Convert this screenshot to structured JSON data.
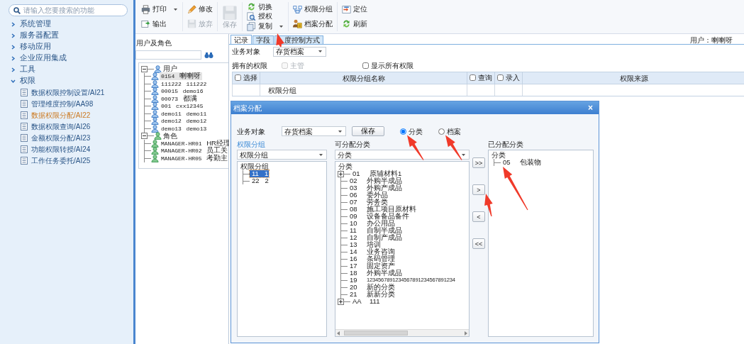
{
  "sidebar": {
    "search": {
      "placeholder": "请输入您要搜索的功能"
    },
    "items": [
      {
        "label": "系统管理",
        "expanded": false
      },
      {
        "label": "服务器配置",
        "expanded": false
      },
      {
        "label": "移动应用",
        "expanded": false
      },
      {
        "label": "企业应用集成",
        "expanded": false
      },
      {
        "label": "工具",
        "expanded": false
      },
      {
        "label": "权限",
        "expanded": true,
        "children": [
          {
            "label": "数据权限控制设置/AI21",
            "selected": false
          },
          {
            "label": "管理维度控制/AA98",
            "selected": false
          },
          {
            "label": "数据权限分配/AI22",
            "selected": true
          },
          {
            "label": "数据权限查询/AI26",
            "selected": false
          },
          {
            "label": "金额权限分配/AI23",
            "selected": false
          },
          {
            "label": "功能权限转授/AI24",
            "selected": false
          },
          {
            "label": "工作任务委托/AI25",
            "selected": false
          }
        ]
      }
    ]
  },
  "toolbar": {
    "groups": [
      {
        "kind": "stack",
        "buttons": [
          {
            "label": "打印",
            "dropdown": true,
            "disabled": false
          },
          {
            "label": "输出",
            "dropdown": false,
            "disabled": false
          }
        ]
      },
      {
        "kind": "stack",
        "buttons": [
          {
            "label": "修改",
            "dropdown": false,
            "disabled": false
          },
          {
            "label": "放弃",
            "dropdown": false,
            "disabled": true
          }
        ]
      },
      {
        "kind": "large",
        "buttons": [
          {
            "label": "保存",
            "dropdown": false,
            "disabled": true
          }
        ]
      },
      {
        "kind": "stack",
        "buttons": [
          {
            "label": "切换",
            "dropdown": false,
            "disabled": false
          },
          {
            "label": "授权",
            "dropdown": false,
            "disabled": false
          },
          {
            "label": "复制",
            "dropdown": true,
            "disabled": false
          }
        ]
      },
      {
        "kind": "stack",
        "buttons": [
          {
            "label": "权限分组",
            "dropdown": false,
            "disabled": false
          },
          {
            "label": "档案分配",
            "dropdown": false,
            "disabled": false
          }
        ]
      },
      {
        "kind": "stack",
        "buttons": [
          {
            "label": "定位",
            "dropdown": false,
            "disabled": false
          },
          {
            "label": "刷新",
            "dropdown": false,
            "disabled": false
          }
        ]
      }
    ]
  },
  "users_panel": {
    "title": "用户及角色",
    "tree": [
      {
        "label": "用户",
        "kind": "user",
        "expanded": true,
        "children": [
          {
            "code": "0154",
            "name": "喇喇呀",
            "selected": true
          },
          {
            "code": "111222",
            "name": "111222",
            "selected": false
          },
          {
            "code": "00015",
            "name": "demo16",
            "selected": false
          },
          {
            "code": "00073",
            "name": "都满",
            "selected": false
          },
          {
            "code": "001",
            "name": "cxx12345",
            "selected": false
          },
          {
            "code": "demo11",
            "name": "demo11",
            "selected": false
          },
          {
            "code": "demo12",
            "name": "demo12",
            "selected": false
          },
          {
            "code": "demo13",
            "name": "demo13",
            "selected": false
          }
        ]
      },
      {
        "label": "角色",
        "kind": "role",
        "expanded": true,
        "children": [
          {
            "code": "MANAGER-HR01",
            "name": "HR经理",
            "selected": false
          },
          {
            "code": "MANAGER-HR02",
            "name": "员工关",
            "selected": false
          },
          {
            "code": "MANAGER-HR05",
            "name": "考勤主",
            "selected": false
          }
        ]
      }
    ]
  },
  "main": {
    "tabs": [
      {
        "label": "记录",
        "selected": true
      },
      {
        "label": "字段",
        "selected": false
      },
      {
        "label": "度控制方式",
        "selected": false
      }
    ],
    "user": "用户：喇喇呀",
    "business_object": {
      "label": "业务对象",
      "value": "存货档案"
    },
    "owned_label": "拥有的权限",
    "options": [
      {
        "label": "主管",
        "checked": false,
        "disabled": true
      },
      {
        "label": "显示所有权限",
        "checked": false,
        "disabled": false
      }
    ],
    "table": {
      "columns": [
        {
          "label": "选择",
          "checkbox": true,
          "checked": false
        },
        {
          "label": "权限分组名称",
          "checkbox": false
        },
        {
          "label": "查询",
          "checkbox": true,
          "checked": false
        },
        {
          "label": "录入",
          "checkbox": true,
          "checked": false
        },
        {
          "label": "权限来源",
          "checkbox": false
        }
      ],
      "rows": [
        {
          "name": "权限分组"
        }
      ]
    }
  },
  "dialog": {
    "title": "档案分配",
    "close": "×",
    "business_object": {
      "label": "业务对象",
      "value": "存货档案"
    },
    "save": "保存",
    "radios": [
      {
        "label": "分类",
        "selected": true
      },
      {
        "label": "档案",
        "selected": false
      }
    ],
    "group_panel": {
      "heading": "权限分组",
      "select": "权限分组",
      "root": "权限分组",
      "children": [
        {
          "code": "11",
          "name": "1",
          "selected": true
        },
        {
          "code": "22",
          "name": "2",
          "selected": false
        }
      ]
    },
    "available": {
      "heading": "可分配分类",
      "select": "分类",
      "root": "分类",
      "children": [
        {
          "code": "01",
          "name": "原辅材料1",
          "expandable": true
        },
        {
          "code": "02",
          "name": "外购半成品",
          "expandable": false
        },
        {
          "code": "03",
          "name": "外购产成品",
          "expandable": false
        },
        {
          "code": "06",
          "name": "委外品",
          "expandable": false
        },
        {
          "code": "07",
          "name": "劳务类",
          "expandable": false
        },
        {
          "code": "08",
          "name": "施工项目原材料",
          "expandable": false
        },
        {
          "code": "09",
          "name": "设备备品备件",
          "expandable": false
        },
        {
          "code": "10",
          "name": "办公用品",
          "expandable": false
        },
        {
          "code": "11",
          "name": "自制半成品",
          "expandable": false
        },
        {
          "code": "12",
          "name": "自制产成品",
          "expandable": false
        },
        {
          "code": "13",
          "name": "培训",
          "expandable": false
        },
        {
          "code": "14",
          "name": "业务咨询",
          "expandable": false
        },
        {
          "code": "16",
          "name": "条码管理",
          "expandable": false
        },
        {
          "code": "17",
          "name": "固定资产",
          "expandable": false
        },
        {
          "code": "18",
          "name": "外购半成品",
          "expandable": false
        },
        {
          "code": "19",
          "name": "1234567891234567891234567891234",
          "expandable": false
        },
        {
          "code": "20",
          "name": "新的分类",
          "expandable": false
        },
        {
          "code": "21",
          "name": "新新分类",
          "expandable": false
        },
        {
          "code": "AA",
          "name": "111",
          "expandable": true
        }
      ]
    },
    "transfer_buttons": [
      ">>",
      ">",
      "<",
      "<<"
    ],
    "assigned": {
      "heading": "已分配分类",
      "root": "分类",
      "children": [
        {
          "code": "05",
          "name": "包装物"
        }
      ]
    }
  }
}
